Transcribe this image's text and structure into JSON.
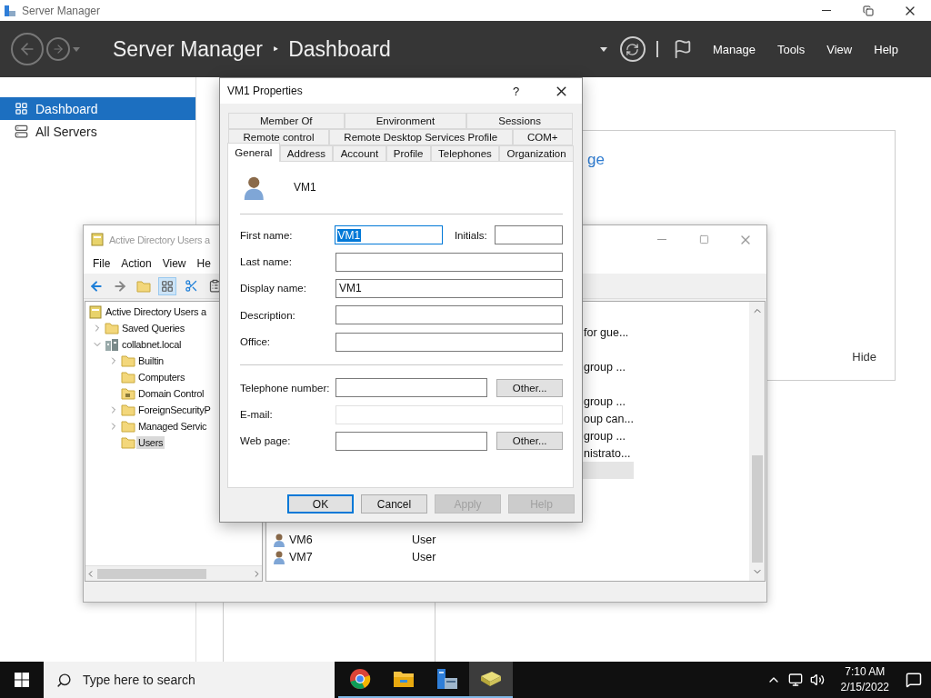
{
  "server_manager": {
    "title": "Server Manager",
    "breadcrumb": {
      "root": "Server Manager",
      "separator": "‣",
      "page": "Dashboard"
    },
    "menu": [
      "Manage",
      "Tools",
      "View",
      "Help"
    ],
    "sidebar": [
      {
        "label": "Dashboard",
        "selected": true,
        "kind": "dashboard"
      },
      {
        "label": "All Servers",
        "selected": false,
        "kind": "servers"
      }
    ],
    "tile": {
      "heading": "ge",
      "link": "Hide"
    }
  },
  "ad_window": {
    "title": "Active Directory Users a",
    "menu": [
      "File",
      "Action",
      "View",
      "He"
    ],
    "tree": [
      {
        "label": "Active Directory Users a",
        "kind": "console",
        "selected": false,
        "children": [
          {
            "label": "Saved Queries",
            "kind": "folder",
            "selected": false,
            "expanded": false
          },
          {
            "label": "collabnet.local",
            "kind": "domain",
            "selected": false,
            "expanded": true,
            "children": [
              {
                "label": "Builtin",
                "kind": "folder",
                "selected": false,
                "expanded": false
              },
              {
                "label": "Computers",
                "kind": "folder",
                "selected": false
              },
              {
                "label": "Domain Control",
                "kind": "ou",
                "selected": false
              },
              {
                "label": "ForeignSecurityP",
                "kind": "folder",
                "selected": false,
                "expanded": false
              },
              {
                "label": "Managed Servic",
                "kind": "folder",
                "selected": false,
                "expanded": false
              },
              {
                "label": "Users",
                "kind": "folder",
                "selected": true
              }
            ]
          }
        ]
      }
    ],
    "rows": [
      {
        "selected": false,
        "description": "for gue..."
      },
      {
        "selected": false
      },
      {
        "selected": false,
        "description": "group ..."
      },
      {
        "selected": false
      },
      {
        "selected": false,
        "description": "group ..."
      },
      {
        "selected": false,
        "description": "oup can..."
      },
      {
        "selected": false,
        "description": "group ..."
      },
      {
        "selected": false,
        "description": "nistrato..."
      },
      {
        "selected": true
      },
      {
        "selected": false
      },
      {
        "selected": false
      },
      {
        "selected": false
      },
      {
        "selected": false,
        "name": "VM6",
        "type": "User"
      },
      {
        "selected": false,
        "name": "VM7",
        "type": "User"
      }
    ]
  },
  "dialog": {
    "title": "VM1 Properties",
    "help": "?",
    "tab_rows": [
      [
        {
          "label": "Member Of",
          "selected": false
        },
        {
          "label": "Environment",
          "selected": false
        },
        {
          "label": "Sessions",
          "selected": false
        }
      ],
      [
        {
          "label": "Remote control",
          "selected": false
        },
        {
          "label": "Remote Desktop Services Profile",
          "selected": false
        },
        {
          "label": "COM+",
          "selected": false
        }
      ],
      [
        {
          "label": "General",
          "selected": true
        },
        {
          "label": "Address",
          "selected": false
        },
        {
          "label": "Account",
          "selected": false
        },
        {
          "label": "Profile",
          "selected": false
        },
        {
          "label": "Telephones",
          "selected": false
        },
        {
          "label": "Organization",
          "selected": false
        }
      ]
    ],
    "object_name": "VM1",
    "sections": [
      {
        "fields": [
          {
            "label": "First name:",
            "value": "VM1",
            "focused": true,
            "disabled": false,
            "side_label": "Initials:"
          },
          {
            "label": "Last name:",
            "focused": false,
            "disabled": false
          },
          {
            "label": "Display name:",
            "value": "VM1",
            "focused": false,
            "disabled": false
          },
          {
            "label": "Description:",
            "focused": false,
            "disabled": false
          },
          {
            "label": "Office:",
            "focused": false,
            "disabled": false
          }
        ]
      },
      {
        "fields": [
          {
            "label": "Telephone number:",
            "focused": false,
            "disabled": false,
            "button": "Other..."
          },
          {
            "label": "E-mail:",
            "focused": false,
            "disabled": true
          },
          {
            "label": "Web page:",
            "focused": false,
            "disabled": false,
            "button": "Other..."
          }
        ]
      }
    ],
    "buttons": [
      {
        "label": "OK",
        "default": true,
        "disabled": false
      },
      {
        "label": "Cancel",
        "default": false,
        "disabled": false
      },
      {
        "label": "Apply",
        "default": false,
        "disabled": true
      },
      {
        "label": "Help",
        "default": false,
        "disabled": true
      }
    ]
  },
  "taskbar": {
    "search": {
      "placeholder": "Type here to search"
    },
    "apps": [
      {
        "kind": "browser",
        "active": false
      },
      {
        "kind": "files",
        "active": false
      },
      {
        "kind": "server",
        "active": false
      },
      {
        "kind": "directory",
        "active": true
      }
    ],
    "time": "7:10 AM",
    "date": "2/15/2022"
  }
}
